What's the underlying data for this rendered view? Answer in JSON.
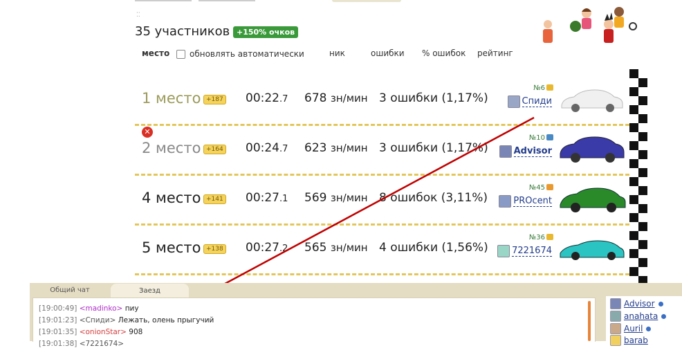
{
  "header": {
    "participants": "35 участников",
    "bonus": "+150% очков"
  },
  "columns": {
    "place": "место",
    "auto_update": "обновлять автоматически",
    "nick": "ник",
    "errors": "ошибки",
    "error_pct": "% ошибок",
    "rating": "рейтинг"
  },
  "results": [
    {
      "place": "1 место",
      "points": "+187",
      "time_main": "00:22",
      "time_frac": ".7",
      "speed": "678",
      "speed_unit": "зн/мин",
      "errors": "3 ошибки (1,17%)",
      "rank": "№6",
      "user": "Спиди",
      "car_color": "#f2f2f2"
    },
    {
      "place": "2 место",
      "points": "+164",
      "time_main": "00:24",
      "time_frac": ".7",
      "speed": "623",
      "speed_unit": "зн/мин",
      "errors": "3 ошибки (1,17%)",
      "rank": "№10",
      "user": "Advisor",
      "car_color": "#3a3aa8"
    },
    {
      "place": "4 место",
      "points": "+141",
      "time_main": "00:27",
      "time_frac": ".1",
      "speed": "569",
      "speed_unit": "зн/мин",
      "errors": "8 ошибок (3,11%)",
      "rank": "№45",
      "user": "PROcent",
      "car_color": "#2a8a2a"
    },
    {
      "place": "5 место",
      "points": "+138",
      "time_main": "00:27",
      "time_frac": ".2",
      "speed": "565",
      "speed_unit": "зн/мин",
      "errors": "4 ошибки (1,56%)",
      "rank": "№36",
      "user": "7221674",
      "car_color": "#2cc3c3"
    }
  ],
  "chat": {
    "tabs": [
      "Общий чат",
      "Заезд"
    ],
    "messages": [
      {
        "time": "[19:00:49]",
        "nick": "<madinko>",
        "text": "пиу"
      },
      {
        "time": "[19:01:23]",
        "nick": "<Спиди>",
        "text": "Лежать, олень прыгучий"
      },
      {
        "time": "[19:01:35]",
        "nick": "<onionStar>",
        "text": "908"
      },
      {
        "time": "[19:01:38]",
        "nick": "<7221674>",
        "text": ""
      }
    ],
    "users": [
      "Advisor",
      "anahata",
      "Auril",
      "barab"
    ]
  },
  "colors": {
    "bonus_bg": "#3a9a3a",
    "dash": "#e3c659",
    "arrow": "#c00000",
    "chat_frame": "#e4dcc3"
  }
}
